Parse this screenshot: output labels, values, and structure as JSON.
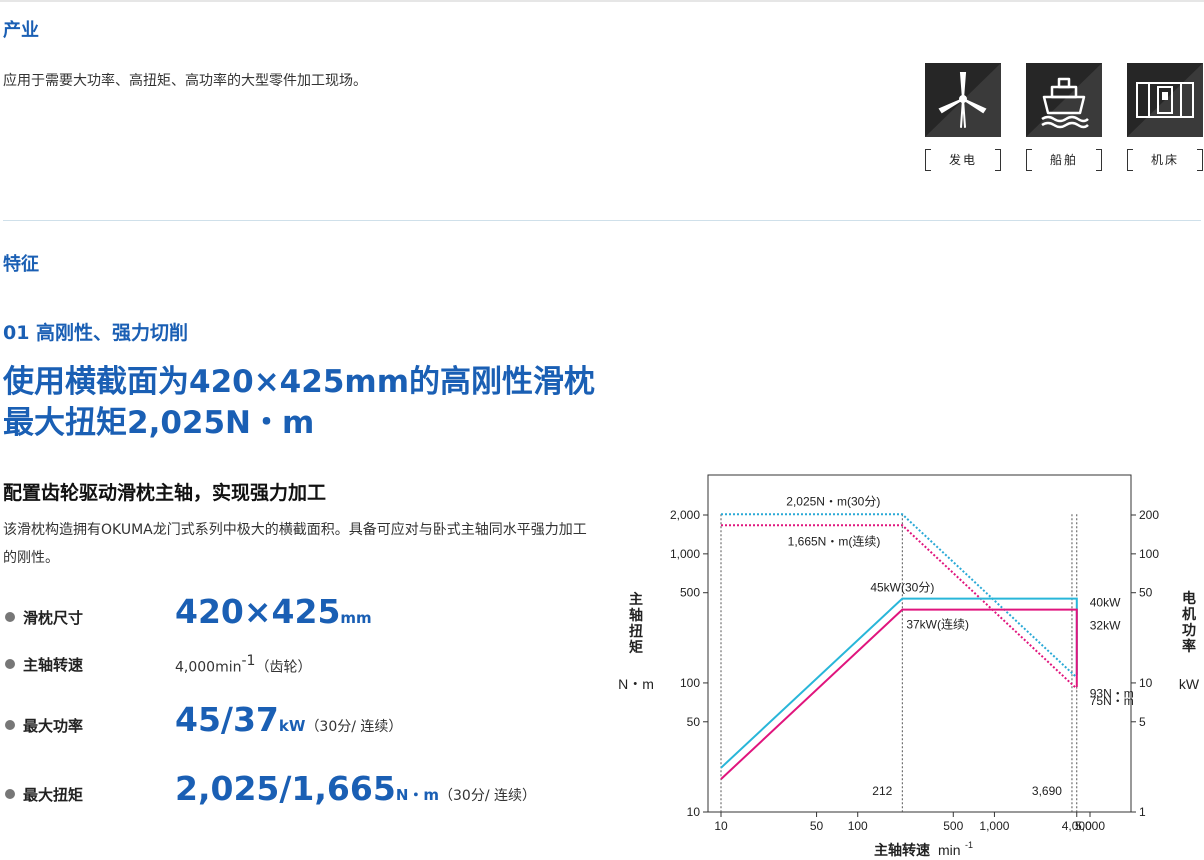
{
  "industry": {
    "heading": "产业",
    "description": "应用于需要大功率、高扭矩、高功率的大型零件加工现场。",
    "icons": [
      {
        "name": "wind-turbine-icon",
        "label": "发电"
      },
      {
        "name": "ship-icon",
        "label": "船舶"
      },
      {
        "name": "machine-tool-icon",
        "label": "机床"
      }
    ]
  },
  "features": {
    "heading": "特征",
    "subheading": "01 高刚性、强力切削",
    "headline_line1": "使用横截面为420×425mm的高刚性滑枕",
    "headline_line2": "最大扭矩2,025N・m",
    "subheadline": "配置齿轮驱动滑枕主轴，实现强力加工",
    "body": "该滑枕构造拥有OKUMA龙门式系列中极大的横截面积。具备可应对与卧式主轴同水平强力加工的刚性。",
    "specs": {
      "ram": {
        "label": "滑枕尺寸",
        "value": "420×425",
        "unit": "mm"
      },
      "speed": {
        "label": "主轴转速",
        "value": "4,000min",
        "sup": "-1",
        "note": "（齿轮）"
      },
      "power": {
        "label": "最大功率",
        "value": "45/37",
        "unit": "kW",
        "note": "（30分/ 连续）"
      },
      "torque": {
        "label": "最大扭矩",
        "value": "2,025/1,665",
        "unit": "N・m",
        "note": "（30分/ 连续）"
      }
    }
  },
  "chart_data": {
    "type": "line",
    "x_scale": "log",
    "y_scale": "log",
    "xlim": [
      10,
      5000
    ],
    "ylim_torque": [
      10,
      2000
    ],
    "ylim_power": [
      1,
      200
    ],
    "xlabel": "主轴转速",
    "xunit": "min",
    "xunit_sup": "-1",
    "ylabel_left": "主轴扭矩",
    "ylabel_left_unit": "N・m",
    "ylabel_right": "电机功率",
    "ylabel_right_unit": "kW",
    "x_ticks": [
      {
        "value": 10,
        "label": "10"
      },
      {
        "value": 50,
        "label": "50"
      },
      {
        "value": 100,
        "label": "100"
      },
      {
        "value": 500,
        "label": "500"
      },
      {
        "value": 1000,
        "label": "1,000"
      },
      {
        "value": 4000,
        "label": "4,000"
      },
      {
        "value": 5000,
        "label": "5,000"
      }
    ],
    "y_left_ticks": [
      {
        "value": 10,
        "label": "10"
      },
      {
        "value": 50,
        "label": "50"
      },
      {
        "value": 100,
        "label": "100"
      },
      {
        "value": 500,
        "label": "500"
      },
      {
        "value": 1000,
        "label": "1,000"
      },
      {
        "value": 2000,
        "label": "2,000"
      }
    ],
    "y_right_ticks": [
      {
        "value": 1,
        "label": "1"
      },
      {
        "value": 5,
        "label": "5"
      },
      {
        "value": 10,
        "label": "10"
      },
      {
        "value": 50,
        "label": "50"
      },
      {
        "value": 100,
        "label": "100"
      },
      {
        "value": 200,
        "label": "200"
      }
    ],
    "series": [
      {
        "key": "torque30",
        "axis": "torque",
        "style": "dotted",
        "color": "#29a9d6",
        "points": [
          [
            10,
            2025
          ],
          [
            212,
            2025
          ],
          [
            4000,
            110
          ]
        ]
      },
      {
        "key": "torqueCont",
        "axis": "torque",
        "style": "dotted",
        "color": "#e0157d",
        "points": [
          [
            10,
            1665
          ],
          [
            212,
            1665
          ],
          [
            4000,
            90
          ]
        ]
      },
      {
        "key": "power30",
        "axis": "power",
        "style": "solid",
        "color": "#29b6d9",
        "points": [
          [
            10,
            2.2
          ],
          [
            212,
            45
          ],
          [
            4000,
            45
          ],
          [
            4000,
            11.5
          ]
        ]
      },
      {
        "key": "powerCont",
        "axis": "power",
        "style": "solid",
        "color": "#e0157d",
        "points": [
          [
            10,
            1.8
          ],
          [
            212,
            37
          ],
          [
            4000,
            37
          ],
          [
            4000,
            9.3
          ]
        ]
      }
    ],
    "vlines": [
      212,
      3690,
      4000
    ],
    "hline_torque": 2025,
    "annotations": [
      {
        "text": "2,025N・m(30分)",
        "x": 212,
        "y_torque": 2025,
        "pos": "above-left"
      },
      {
        "text": "1,665N・m(连续)",
        "x": 212,
        "y_torque": 1665,
        "pos": "below-left"
      },
      {
        "text": "45kW(30分)",
        "x": 212,
        "y_power": 45,
        "pos": "above"
      },
      {
        "text": "37kW(连续)",
        "x": 212,
        "y_power": 37,
        "pos": "below-right"
      },
      {
        "text": "40kW",
        "x": 4000,
        "y_power": 45,
        "pos": "right"
      },
      {
        "text": "32kW",
        "x": 4000,
        "y_power": 37,
        "pos": "right-below"
      },
      {
        "text": "93N・m",
        "x": 4000,
        "y_torque": 110,
        "pos": "right-below"
      },
      {
        "text": "75N・m",
        "x": 4000,
        "y_torque": 90,
        "pos": "right-below2"
      },
      {
        "text": "212",
        "x": 212,
        "pos": "bottom-left"
      },
      {
        "text": "3,690",
        "x": 3690,
        "pos": "bottom-left"
      }
    ]
  }
}
